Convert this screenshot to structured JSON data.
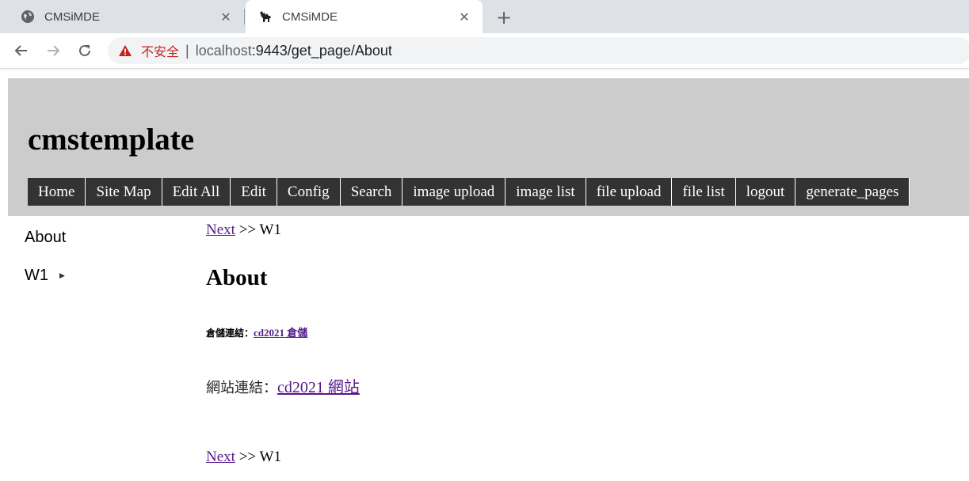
{
  "browser": {
    "tabs": [
      {
        "title": "CMSiMDE",
        "icon": "globe-icon",
        "active": false
      },
      {
        "title": "CMSiMDE",
        "icon": "camel-icon",
        "active": true
      }
    ],
    "security_label": "不安全",
    "url_host": "localhost",
    "url_rest": ":9443/get_page/About"
  },
  "site": {
    "title": "cmstemplate",
    "menu": [
      "Home",
      "Site Map",
      "Edit All",
      "Edit",
      "Config",
      "Search",
      "image upload",
      "image list",
      "file upload",
      "file list",
      "logout",
      "generate_pages"
    ]
  },
  "sidebar": {
    "items": [
      {
        "label": "About"
      },
      {
        "label": "W1",
        "has_submenu": true
      }
    ]
  },
  "content": {
    "breadcrumb_top": {
      "link": "Next",
      "sep": " >> ",
      "target": "W1"
    },
    "heading": "About",
    "repo_label": "倉儲連結：",
    "repo_link": "cd2021 倉儲",
    "site_label": "網站連結：",
    "site_link": "cd2021 網站",
    "breadcrumb_bottom": {
      "link": "Next",
      "sep": " >> ",
      "target": "W1"
    }
  },
  "colors": {
    "header_bg": "#cccccc",
    "menu_bg": "#333333",
    "visited_link": "#551a8b",
    "warning": "#c5221f"
  }
}
